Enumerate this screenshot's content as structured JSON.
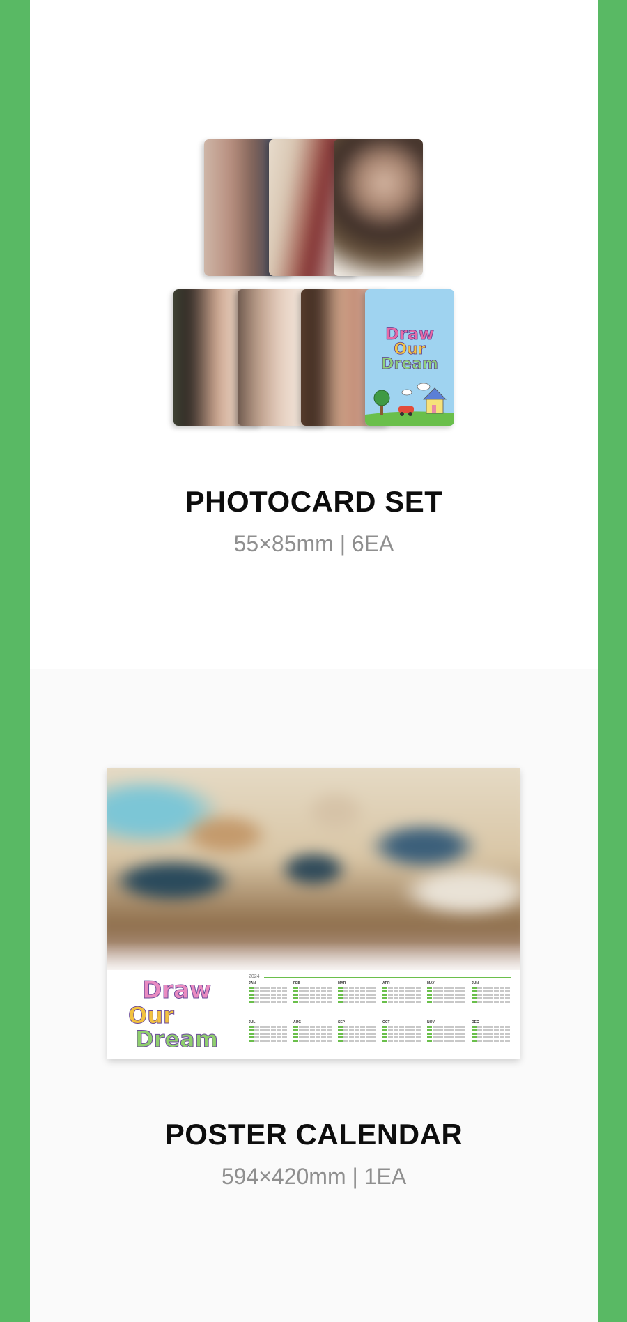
{
  "photocard": {
    "title": "PHOTOCARD SET",
    "spec": "55×85mm | 6EA",
    "cards": [
      {
        "name": "member-photocard-1"
      },
      {
        "name": "member-photocard-2"
      },
      {
        "name": "member-photocard-3"
      },
      {
        "name": "member-photocard-4"
      },
      {
        "name": "member-photocard-5"
      },
      {
        "name": "member-photocard-6"
      }
    ],
    "back_logo": [
      "Draw",
      "Our",
      "Dream"
    ]
  },
  "poster": {
    "title": "POSTER CALENDAR",
    "spec": "594×420mm | 1EA",
    "logo": [
      "Draw",
      "Our",
      "Dream"
    ],
    "year": "2024",
    "months": [
      "JAN",
      "FEB",
      "MAR",
      "APR",
      "MAY",
      "JUN",
      "JUL",
      "AUG",
      "SEP",
      "OCT",
      "NOV",
      "DEC"
    ]
  },
  "colors": {
    "frame": "#59b964",
    "card_back": "#9fd3f0",
    "grass": "#6abf4b"
  }
}
